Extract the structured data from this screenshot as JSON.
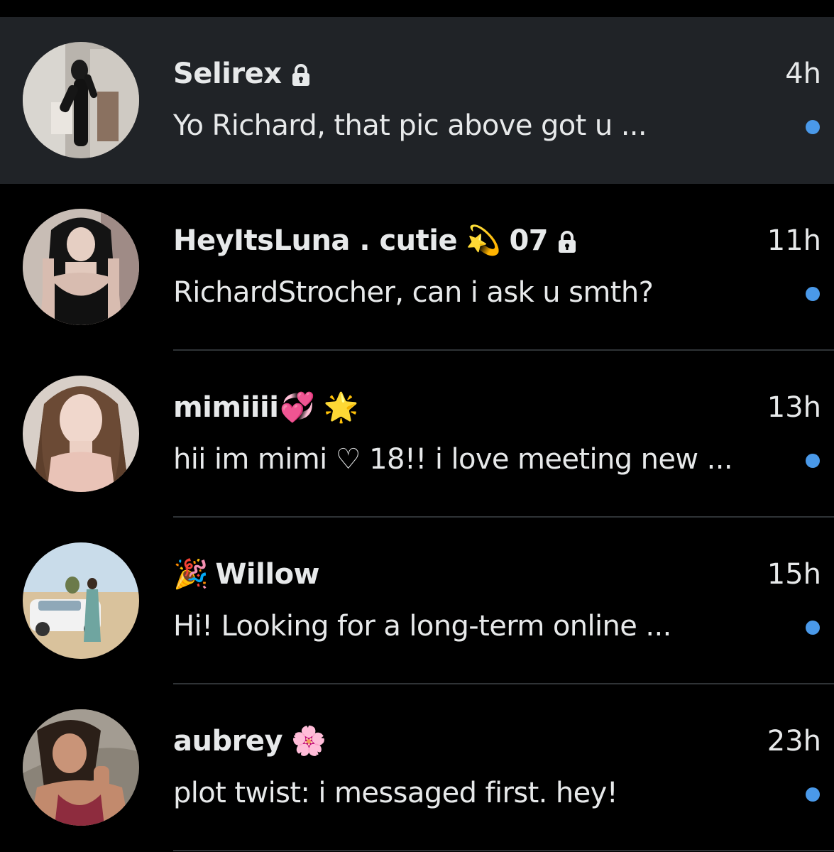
{
  "colors": {
    "background": "#000000",
    "highlight_row": "#202327",
    "text_primary": "#e7e9ea",
    "unread_dot": "#4a99e9",
    "divider": "#2f3336"
  },
  "conversations": [
    {
      "name_parts": [
        "Selirex"
      ],
      "icons": [
        "lock-icon"
      ],
      "preview": "Yo Richard, that pic above got u ...",
      "time": "4h",
      "unread": true
    },
    {
      "name_parts": [
        "HeyItsLuna . cutie",
        "💫",
        "07"
      ],
      "icons": [
        "dizzy-icon",
        "lock-icon"
      ],
      "preview": "RichardStrocher, can i ask u smth?",
      "time": "11h",
      "unread": true
    },
    {
      "name_parts": [
        "mimiiii",
        "💞",
        "🌟"
      ],
      "icons": [
        "revolving-hearts-icon",
        "glowing-star-icon"
      ],
      "preview": "hii im mimi ♡ 18!! i love meeting new ...",
      "time": "13h",
      "unread": true
    },
    {
      "name_parts": [
        "🎉",
        "Willow"
      ],
      "icons": [
        "party-popper-icon"
      ],
      "preview": "Hi!  Looking for a long-term online ...",
      "time": "15h",
      "unread": true
    },
    {
      "name_parts": [
        "aubrey",
        "🌸"
      ],
      "icons": [
        "cherry-blossom-icon"
      ],
      "preview": "plot twist: i messaged first. hey!",
      "time": "23h",
      "unread": true
    }
  ]
}
